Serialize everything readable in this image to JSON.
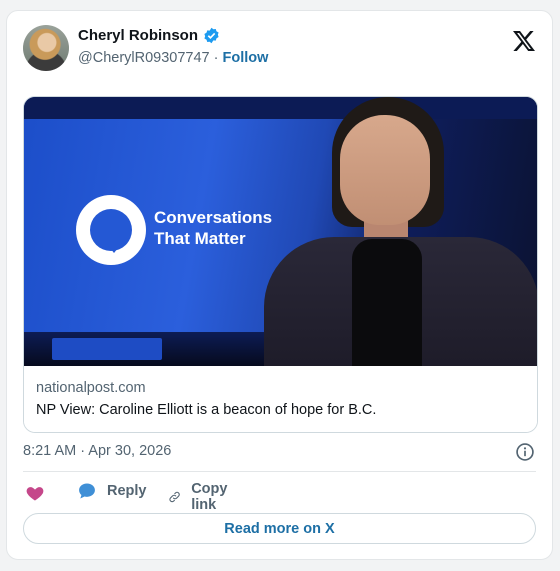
{
  "author": {
    "name": "Cheryl Robinson",
    "handle": "@CherylR09307747",
    "separator": "·",
    "follow_label": "Follow"
  },
  "media": {
    "logo_line1": "Conversations",
    "logo_line2": "That Matter"
  },
  "link": {
    "domain": "nationalpost.com",
    "title": "NP View: Caroline Elliott is a beacon of hope for B.C."
  },
  "meta": {
    "timestamp": "8:21 AM · Apr 30, 2026"
  },
  "actions": {
    "reply_label": "Reply",
    "copy_label": "Copy link"
  },
  "read_more_label": "Read more on X",
  "colors": {
    "accent": "#1d6fa5",
    "verified": "#1d9bf0",
    "heart": "#c5478a",
    "reply_bubble": "#3f8fd6"
  },
  "icons": [
    "verified-badge-icon",
    "x-logo-icon",
    "info-icon",
    "heart-icon",
    "reply-bubble-icon",
    "link-icon"
  ]
}
